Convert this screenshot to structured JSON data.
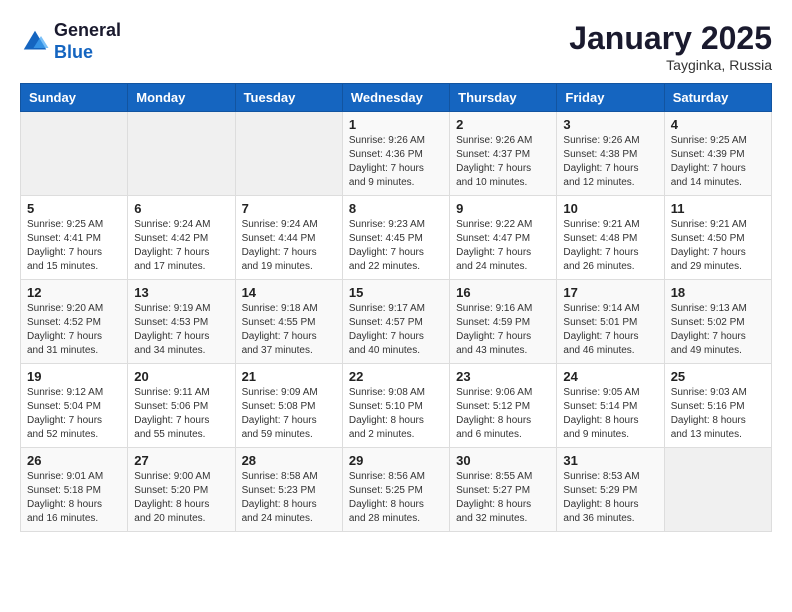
{
  "header": {
    "logo_line1": "General",
    "logo_line2": "Blue",
    "month": "January 2025",
    "location": "Tayginka, Russia"
  },
  "weekdays": [
    "Sunday",
    "Monday",
    "Tuesday",
    "Wednesday",
    "Thursday",
    "Friday",
    "Saturday"
  ],
  "weeks": [
    [
      {
        "day": "",
        "sunrise": "",
        "sunset": "",
        "daylight": ""
      },
      {
        "day": "",
        "sunrise": "",
        "sunset": "",
        "daylight": ""
      },
      {
        "day": "",
        "sunrise": "",
        "sunset": "",
        "daylight": ""
      },
      {
        "day": "1",
        "sunrise": "Sunrise: 9:26 AM",
        "sunset": "Sunset: 4:36 PM",
        "daylight": "Daylight: 7 hours and 9 minutes."
      },
      {
        "day": "2",
        "sunrise": "Sunrise: 9:26 AM",
        "sunset": "Sunset: 4:37 PM",
        "daylight": "Daylight: 7 hours and 10 minutes."
      },
      {
        "day": "3",
        "sunrise": "Sunrise: 9:26 AM",
        "sunset": "Sunset: 4:38 PM",
        "daylight": "Daylight: 7 hours and 12 minutes."
      },
      {
        "day": "4",
        "sunrise": "Sunrise: 9:25 AM",
        "sunset": "Sunset: 4:39 PM",
        "daylight": "Daylight: 7 hours and 14 minutes."
      }
    ],
    [
      {
        "day": "5",
        "sunrise": "Sunrise: 9:25 AM",
        "sunset": "Sunset: 4:41 PM",
        "daylight": "Daylight: 7 hours and 15 minutes."
      },
      {
        "day": "6",
        "sunrise": "Sunrise: 9:24 AM",
        "sunset": "Sunset: 4:42 PM",
        "daylight": "Daylight: 7 hours and 17 minutes."
      },
      {
        "day": "7",
        "sunrise": "Sunrise: 9:24 AM",
        "sunset": "Sunset: 4:44 PM",
        "daylight": "Daylight: 7 hours and 19 minutes."
      },
      {
        "day": "8",
        "sunrise": "Sunrise: 9:23 AM",
        "sunset": "Sunset: 4:45 PM",
        "daylight": "Daylight: 7 hours and 22 minutes."
      },
      {
        "day": "9",
        "sunrise": "Sunrise: 9:22 AM",
        "sunset": "Sunset: 4:47 PM",
        "daylight": "Daylight: 7 hours and 24 minutes."
      },
      {
        "day": "10",
        "sunrise": "Sunrise: 9:21 AM",
        "sunset": "Sunset: 4:48 PM",
        "daylight": "Daylight: 7 hours and 26 minutes."
      },
      {
        "day": "11",
        "sunrise": "Sunrise: 9:21 AM",
        "sunset": "Sunset: 4:50 PM",
        "daylight": "Daylight: 7 hours and 29 minutes."
      }
    ],
    [
      {
        "day": "12",
        "sunrise": "Sunrise: 9:20 AM",
        "sunset": "Sunset: 4:52 PM",
        "daylight": "Daylight: 7 hours and 31 minutes."
      },
      {
        "day": "13",
        "sunrise": "Sunrise: 9:19 AM",
        "sunset": "Sunset: 4:53 PM",
        "daylight": "Daylight: 7 hours and 34 minutes."
      },
      {
        "day": "14",
        "sunrise": "Sunrise: 9:18 AM",
        "sunset": "Sunset: 4:55 PM",
        "daylight": "Daylight: 7 hours and 37 minutes."
      },
      {
        "day": "15",
        "sunrise": "Sunrise: 9:17 AM",
        "sunset": "Sunset: 4:57 PM",
        "daylight": "Daylight: 7 hours and 40 minutes."
      },
      {
        "day": "16",
        "sunrise": "Sunrise: 9:16 AM",
        "sunset": "Sunset: 4:59 PM",
        "daylight": "Daylight: 7 hours and 43 minutes."
      },
      {
        "day": "17",
        "sunrise": "Sunrise: 9:14 AM",
        "sunset": "Sunset: 5:01 PM",
        "daylight": "Daylight: 7 hours and 46 minutes."
      },
      {
        "day": "18",
        "sunrise": "Sunrise: 9:13 AM",
        "sunset": "Sunset: 5:02 PM",
        "daylight": "Daylight: 7 hours and 49 minutes."
      }
    ],
    [
      {
        "day": "19",
        "sunrise": "Sunrise: 9:12 AM",
        "sunset": "Sunset: 5:04 PM",
        "daylight": "Daylight: 7 hours and 52 minutes."
      },
      {
        "day": "20",
        "sunrise": "Sunrise: 9:11 AM",
        "sunset": "Sunset: 5:06 PM",
        "daylight": "Daylight: 7 hours and 55 minutes."
      },
      {
        "day": "21",
        "sunrise": "Sunrise: 9:09 AM",
        "sunset": "Sunset: 5:08 PM",
        "daylight": "Daylight: 7 hours and 59 minutes."
      },
      {
        "day": "22",
        "sunrise": "Sunrise: 9:08 AM",
        "sunset": "Sunset: 5:10 PM",
        "daylight": "Daylight: 8 hours and 2 minutes."
      },
      {
        "day": "23",
        "sunrise": "Sunrise: 9:06 AM",
        "sunset": "Sunset: 5:12 PM",
        "daylight": "Daylight: 8 hours and 6 minutes."
      },
      {
        "day": "24",
        "sunrise": "Sunrise: 9:05 AM",
        "sunset": "Sunset: 5:14 PM",
        "daylight": "Daylight: 8 hours and 9 minutes."
      },
      {
        "day": "25",
        "sunrise": "Sunrise: 9:03 AM",
        "sunset": "Sunset: 5:16 PM",
        "daylight": "Daylight: 8 hours and 13 minutes."
      }
    ],
    [
      {
        "day": "26",
        "sunrise": "Sunrise: 9:01 AM",
        "sunset": "Sunset: 5:18 PM",
        "daylight": "Daylight: 8 hours and 16 minutes."
      },
      {
        "day": "27",
        "sunrise": "Sunrise: 9:00 AM",
        "sunset": "Sunset: 5:20 PM",
        "daylight": "Daylight: 8 hours and 20 minutes."
      },
      {
        "day": "28",
        "sunrise": "Sunrise: 8:58 AM",
        "sunset": "Sunset: 5:23 PM",
        "daylight": "Daylight: 8 hours and 24 minutes."
      },
      {
        "day": "29",
        "sunrise": "Sunrise: 8:56 AM",
        "sunset": "Sunset: 5:25 PM",
        "daylight": "Daylight: 8 hours and 28 minutes."
      },
      {
        "day": "30",
        "sunrise": "Sunrise: 8:55 AM",
        "sunset": "Sunset: 5:27 PM",
        "daylight": "Daylight: 8 hours and 32 minutes."
      },
      {
        "day": "31",
        "sunrise": "Sunrise: 8:53 AM",
        "sunset": "Sunset: 5:29 PM",
        "daylight": "Daylight: 8 hours and 36 minutes."
      },
      {
        "day": "",
        "sunrise": "",
        "sunset": "",
        "daylight": ""
      }
    ]
  ]
}
